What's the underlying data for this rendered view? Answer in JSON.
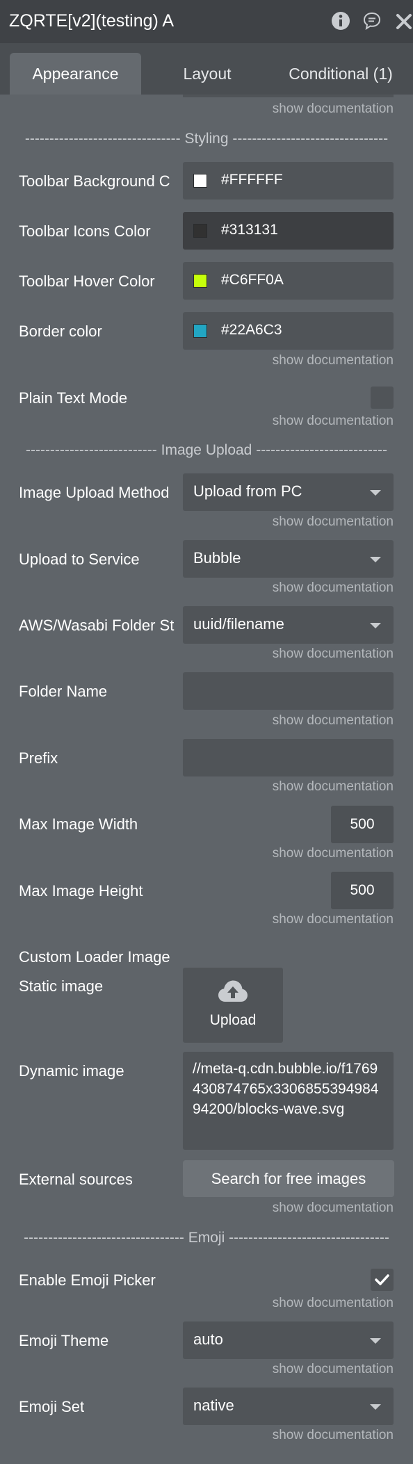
{
  "window": {
    "title": "ZQRTE[v2](testing) A"
  },
  "tabs": {
    "appearance": "Appearance",
    "layout": "Layout",
    "conditional": "Conditional (1)"
  },
  "doc_link": "show documentation",
  "sections": {
    "styling": "-------------------------------- Styling --------------------------------",
    "image_upload": "--------------------------- Image Upload ---------------------------",
    "emoji": "--------------------------------- Emoji ---------------------------------"
  },
  "styling": {
    "toolbar_bg": {
      "label": "Toolbar Background C",
      "value": "#FFFFFF",
      "color": "#FFFFFF"
    },
    "toolbar_icons": {
      "label": "Toolbar Icons Color",
      "value": "#313131",
      "color": "#313131"
    },
    "toolbar_hover": {
      "label": "Toolbar Hover Color",
      "value": "#C6FF0A",
      "color": "#C6FF0A"
    },
    "border_color": {
      "label": "Border color",
      "value": "#22A6C3",
      "color": "#22A6C3"
    },
    "plain_text_mode": {
      "label": "Plain Text Mode",
      "checked": false
    }
  },
  "image_upload": {
    "method": {
      "label": "Image Upload Method",
      "value": "Upload from PC"
    },
    "service": {
      "label": "Upload to Service",
      "value": "Bubble"
    },
    "folder_structure": {
      "label": "AWS/Wasabi Folder St",
      "value": "uuid/filename"
    },
    "folder_name": {
      "label": "Folder Name",
      "value": ""
    },
    "prefix": {
      "label": "Prefix",
      "value": ""
    },
    "max_width": {
      "label": "Max Image Width",
      "value": "500"
    },
    "max_height": {
      "label": "Max Image Height",
      "value": "500"
    },
    "custom_loader_label": "Custom Loader Image",
    "static_image": {
      "label": "Static image",
      "button": "Upload"
    },
    "dynamic_image": {
      "label": "Dynamic image",
      "value": "//meta-q.cdn.bubble.io/f1769430874765x330685539498494200/blocks-wave.svg"
    },
    "external_sources": {
      "label": "External sources",
      "button": "Search for free images"
    }
  },
  "emoji": {
    "enable_picker": {
      "label": "Enable Emoji Picker",
      "checked": true
    },
    "theme": {
      "label": "Emoji Theme",
      "value": "auto"
    },
    "set": {
      "label": "Emoji Set",
      "value": "native"
    }
  },
  "icons": {
    "info": "info-icon",
    "comment": "comment-icon",
    "close": "close-icon",
    "caret": "chevron-down-icon",
    "upload": "cloud-upload-icon",
    "check": "checkmark-icon"
  }
}
